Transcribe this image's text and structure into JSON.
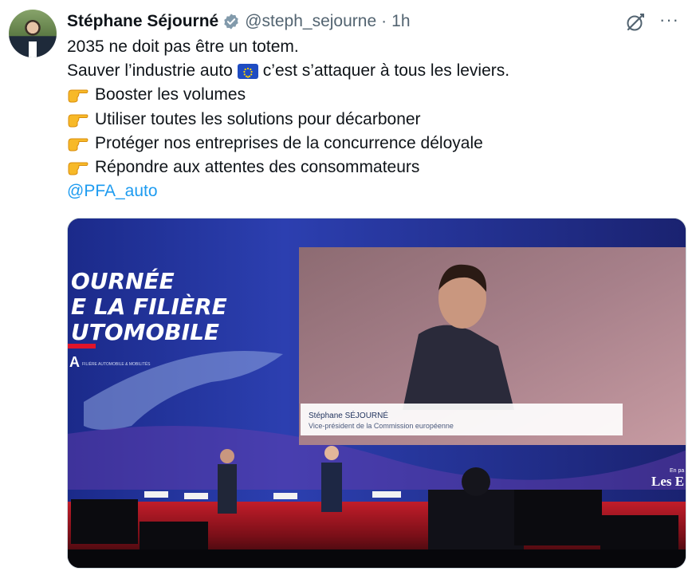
{
  "author": {
    "name": "Stéphane Séjourné",
    "handle": "@steph_sejourne",
    "separator": "·",
    "time": "1h",
    "avatar_icon": "avatar",
    "verified_icon": "verified-badge-icon"
  },
  "actions": {
    "grok_icon": "grok-icon",
    "more_label": "···"
  },
  "tweet": {
    "line1": "2035 ne doit pas être un totem.",
    "line2_a": "Sauver l’industrie auto",
    "line2_flag": "eu-flag",
    "line2_b": "c’est s’attaquer à tous les leviers.",
    "bullets": [
      "Booster les volumes",
      "Utiliser toutes les solutions pour décarboner",
      "Protéger nos entreprises de la concurrence déloyale",
      "Répondre aux attentes des consommateurs"
    ],
    "bullet_icon": "pointing-right-emoji",
    "mention": "@PFA_auto"
  },
  "media": {
    "banner_line1": "OURNÉE",
    "banner_line2": "E LA FILIÈRE",
    "banner_line3": "UTOMOBILE",
    "logo_text": "A",
    "logo_sub": "FILIÈRE AUTOMOBILE & MOBILITÉS",
    "caption_name": "Stéphane SÉJOURNÉ",
    "caption_role": "Vice-président de la Commission européenne",
    "corner_small": "En pa",
    "corner_brand": "Les E"
  },
  "colors": {
    "accent": "#1d9bf0",
    "verified": "#829aab",
    "text": "#0f1419",
    "muted": "#536471"
  }
}
